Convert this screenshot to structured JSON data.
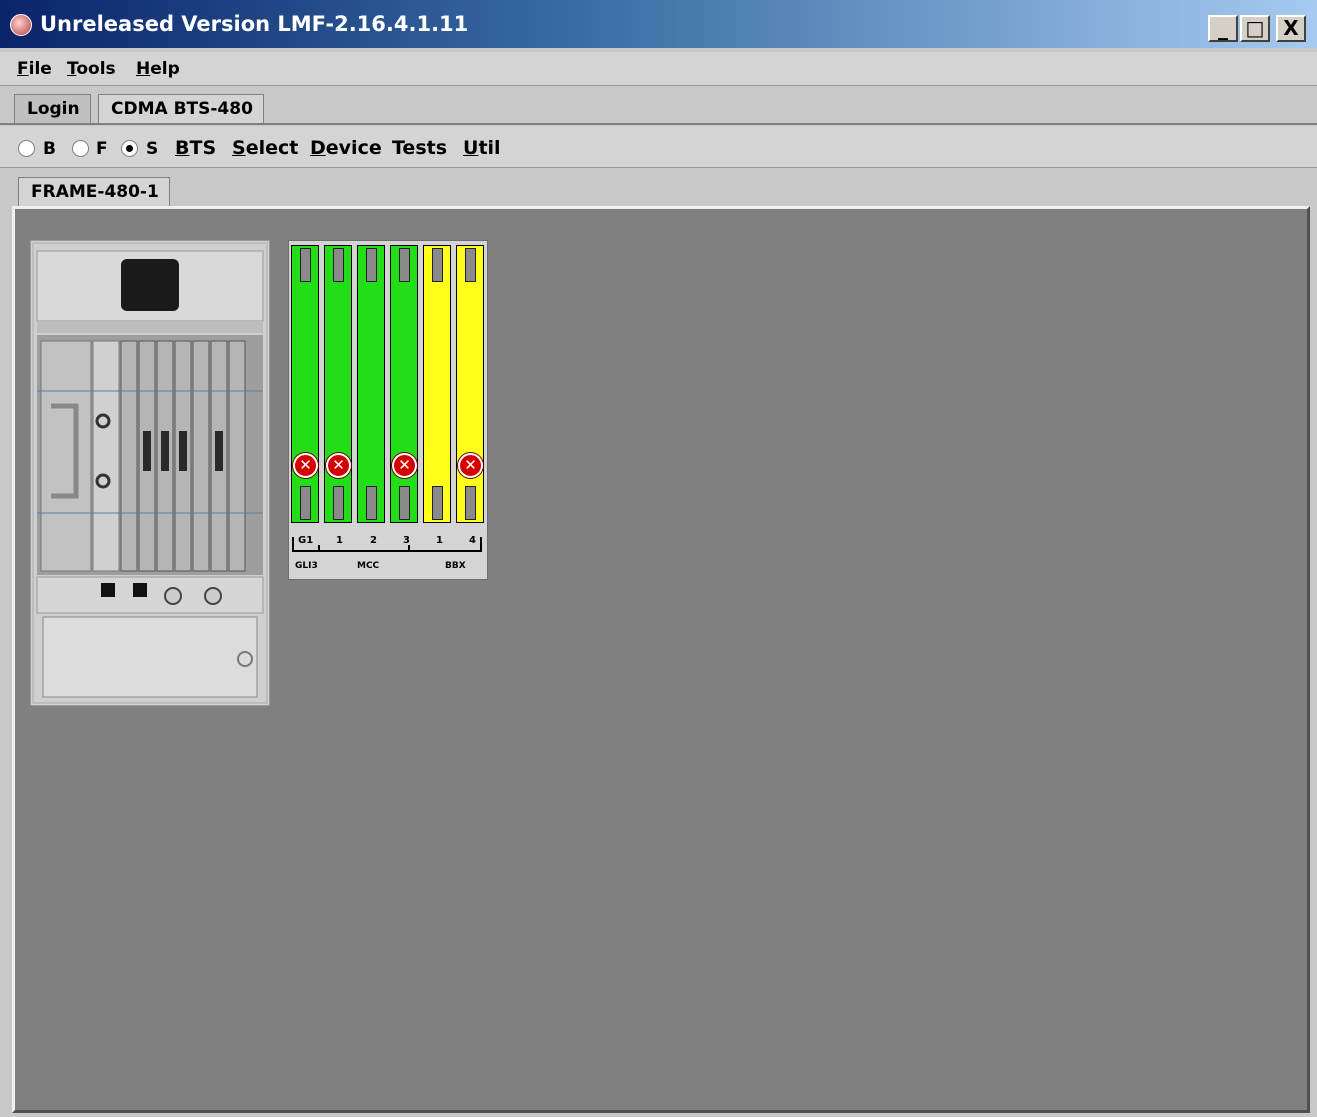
{
  "window": {
    "title": "Unreleased Version LMF-2.16.4.1.11",
    "minimize": "_",
    "maximize": "□",
    "close": "X"
  },
  "menubar": {
    "items": [
      "File",
      "Tools",
      "Help"
    ]
  },
  "main_tabs": [
    "Login",
    "CDMA BTS-480"
  ],
  "toolbar": {
    "radios": [
      {
        "label": "B",
        "checked": false
      },
      {
        "label": "F",
        "checked": false
      },
      {
        "label": "S",
        "checked": true
      }
    ],
    "menus": [
      "BTS",
      "Select",
      "Device",
      "Tests",
      "Util"
    ]
  },
  "frame_tab": "FRAME-480-1",
  "shelf": {
    "cards": [
      {
        "slot": "G1",
        "color": "green",
        "fault": true
      },
      {
        "slot": "1",
        "color": "green",
        "fault": true
      },
      {
        "slot": "2",
        "color": "green",
        "fault": false
      },
      {
        "slot": "3",
        "color": "green",
        "fault": true
      },
      {
        "slot": "1",
        "color": "yellow",
        "fault": false
      },
      {
        "slot": "4",
        "color": "yellow",
        "fault": true
      }
    ],
    "groups": [
      "GLI3",
      "MCC",
      "BBX"
    ]
  }
}
